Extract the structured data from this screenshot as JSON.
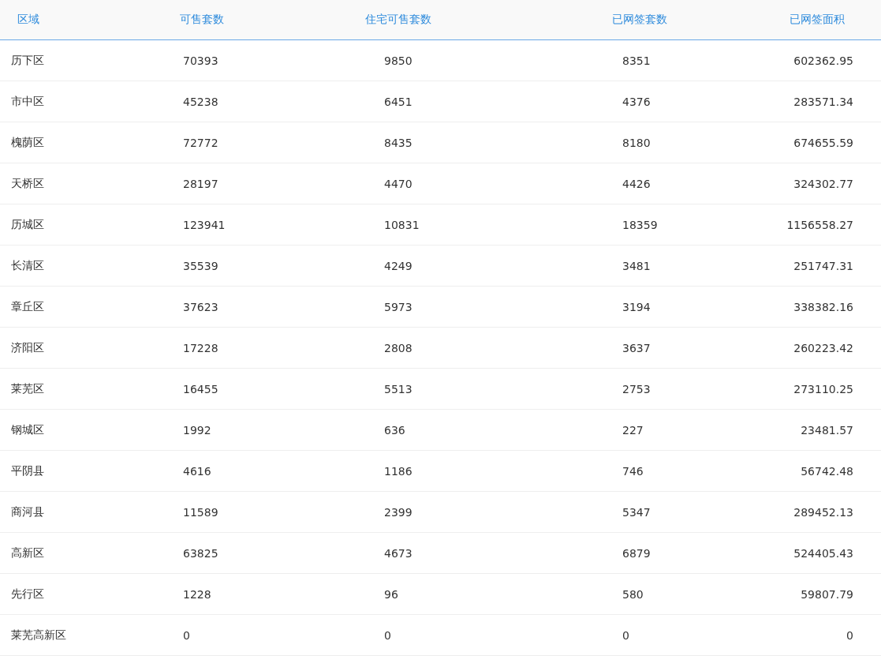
{
  "table": {
    "columns": [
      "区域",
      "可售套数",
      "住宅可售套数",
      "已网签套数",
      "已网签面积"
    ],
    "rows": [
      [
        "历下区",
        "70393",
        "9850",
        "8351",
        "602362.95"
      ],
      [
        "市中区",
        "45238",
        "6451",
        "4376",
        "283571.34"
      ],
      [
        "槐荫区",
        "72772",
        "8435",
        "8180",
        "674655.59"
      ],
      [
        "天桥区",
        "28197",
        "4470",
        "4426",
        "324302.77"
      ],
      [
        "历城区",
        "123941",
        "10831",
        "18359",
        "1156558.27"
      ],
      [
        "长清区",
        "35539",
        "4249",
        "3481",
        "251747.31"
      ],
      [
        "章丘区",
        "37623",
        "5973",
        "3194",
        "338382.16"
      ],
      [
        "济阳区",
        "17228",
        "2808",
        "3637",
        "260223.42"
      ],
      [
        "莱芜区",
        "16455",
        "5513",
        "2753",
        "273110.25"
      ],
      [
        "钢城区",
        "1992",
        "636",
        "227",
        "23481.57"
      ],
      [
        "平阴县",
        "4616",
        "1186",
        "746",
        "56742.48"
      ],
      [
        "商河县",
        "11589",
        "2399",
        "5347",
        "289452.13"
      ],
      [
        "高新区",
        "63825",
        "4673",
        "6879",
        "524405.43"
      ],
      [
        "先行区",
        "1228",
        "96",
        "580",
        "59807.79"
      ],
      [
        "莱芜高新区",
        "0",
        "0",
        "0",
        "0"
      ]
    ]
  }
}
